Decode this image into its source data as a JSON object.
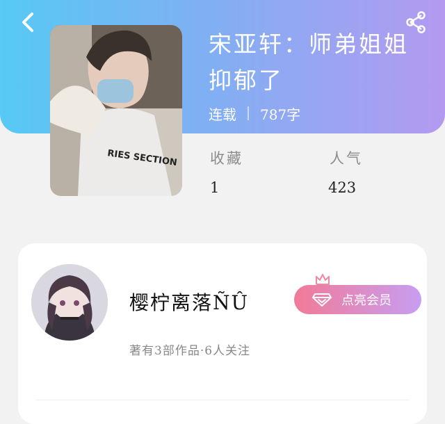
{
  "book": {
    "title": "宋亚轩：师弟姐姐抑郁了",
    "status": "连载",
    "word_count": "787字"
  },
  "stats": {
    "collect_label": "收藏",
    "collect_value": "1",
    "popularity_label": "人气",
    "popularity_value": "423"
  },
  "author": {
    "name": "樱柠离落ÑÛ",
    "summary": "著有3部作品·6人关注"
  },
  "vip_button": {
    "label": "点亮会员"
  },
  "icons": {
    "back": "chevron-left-icon",
    "share": "share-icon",
    "vip": "diamond-icon",
    "crown": "crown-icon"
  },
  "colors": {
    "header_gradient_start": "#56c9f4",
    "header_gradient_end": "#b39af0",
    "vip_gradient_start": "#f27a98",
    "vip_gradient_end": "#c79ef2"
  }
}
